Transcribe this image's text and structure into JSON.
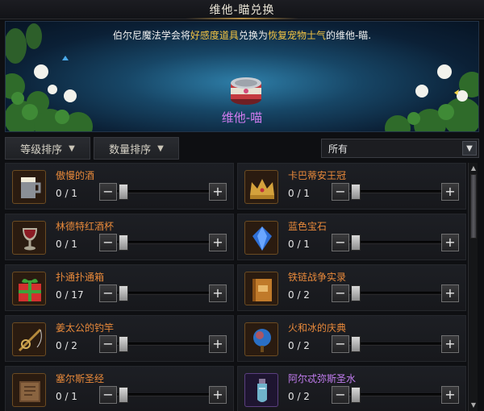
{
  "window": {
    "title": "维他-瞄兑换"
  },
  "banner": {
    "desc_prefix": "伯尔尼魔法学会将",
    "desc_hl1": "好感度道具",
    "desc_mid": "兑换为",
    "desc_hl2": "恢复宠物士气",
    "desc_suffix": "的维他-瞄.",
    "item_name": "维他-喵"
  },
  "sortbar": {
    "level_sort": "等级排序",
    "qty_sort": "数量排序",
    "filter_value": "所有"
  },
  "items": [
    {
      "name": "傲慢的酒",
      "count": "0 / 1",
      "icon": "beer-mug-icon",
      "rarity": "orange"
    },
    {
      "name": "卡巴蒂安王冠",
      "count": "0 / 1",
      "icon": "crown-icon",
      "rarity": "orange"
    },
    {
      "name": "林德特红酒杯",
      "count": "0 / 1",
      "icon": "wine-goblet-icon",
      "rarity": "orange"
    },
    {
      "name": "蓝色宝石",
      "count": "0 / 1",
      "icon": "blue-gem-icon",
      "rarity": "orange"
    },
    {
      "name": "扑通扑通箱",
      "count": "0 / 17",
      "icon": "gift-box-icon",
      "rarity": "orange"
    },
    {
      "name": "铁链战争实录",
      "count": "0 / 2",
      "icon": "book-icon",
      "rarity": "orange"
    },
    {
      "name": "姜太公的钓竿",
      "count": "0 / 2",
      "icon": "fishing-rod-icon",
      "rarity": "orange"
    },
    {
      "name": "火和冰的庆典",
      "count": "0 / 2",
      "icon": "crystal-orb-icon",
      "rarity": "orange"
    },
    {
      "name": "塞尔斯圣经",
      "count": "0 / 1",
      "icon": "scripture-icon",
      "rarity": "orange"
    },
    {
      "name": "阿尔忒弥斯圣水",
      "count": "0 / 2",
      "icon": "holy-water-vial-icon",
      "rarity": "purple"
    }
  ],
  "colors": {
    "orange_name": "#e8893a",
    "purple_name": "#c27df0",
    "highlight": "#f4c443"
  }
}
